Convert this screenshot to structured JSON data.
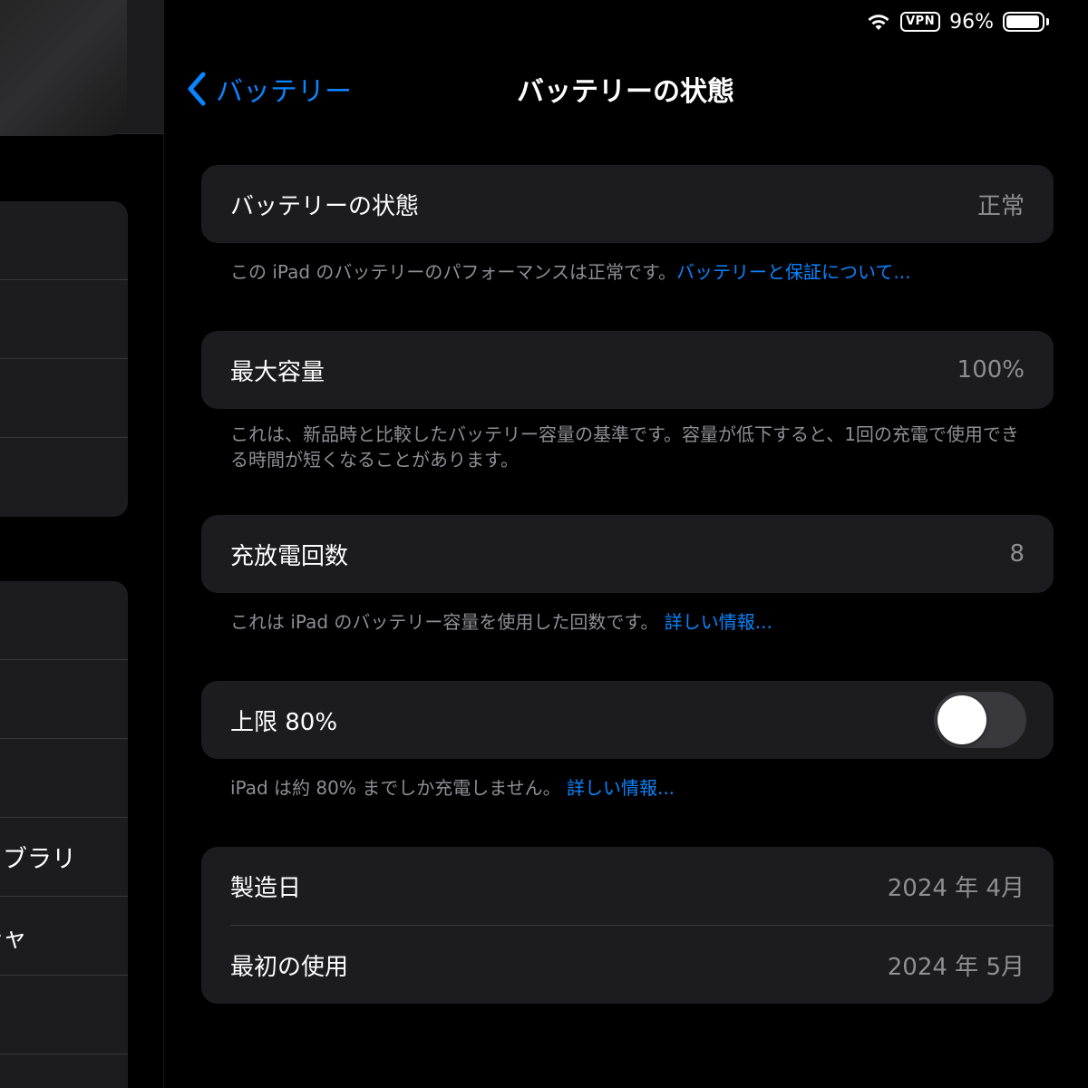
{
  "status_bar": {
    "vpn": "VPN",
    "battery_percent": "96%",
    "battery_level": 0.96,
    "icons": [
      "wifi-icon",
      "vpn-badge",
      "battery-icon"
    ]
  },
  "nav": {
    "back_label": "バッテリー",
    "title": "バッテリーの状態"
  },
  "sidebar": {
    "rows": [
      "",
      "",
      "",
      "",
      "",
      "",
      "",
      "イブラリ",
      "チャ",
      "",
      ""
    ]
  },
  "battery_health": {
    "label": "バッテリーの状態",
    "value": "正常",
    "footnote_text": "この iPad のバッテリーのパフォーマンスは正常です。",
    "footnote_link": "バッテリーと保証について..."
  },
  "max_capacity": {
    "label": "最大容量",
    "value": "100%",
    "footnote_text": "これは、新品時と比較したバッテリー容量の基準です。容量が低下すると、1回の充電で使用できる時間が短くなることがあります。"
  },
  "cycle_count": {
    "label": "充放電回数",
    "value": "8",
    "footnote_text": "これは iPad のバッテリー容量を使用した回数です。",
    "footnote_link": "詳しい情報..."
  },
  "limit": {
    "label": "上限 80%",
    "toggle_on": false,
    "footnote_text": "iPad は約 80% までしか充電しません。",
    "footnote_link": "詳しい情報..."
  },
  "dates": {
    "manufacture_label": "製造日",
    "manufacture_value": "2024 年 4月",
    "first_use_label": "最初の使用",
    "first_use_value": "2024 年 5月"
  },
  "colors": {
    "accent": "#0a84ff",
    "background": "#000000",
    "card": "#1c1c1e",
    "secondary_text": "#8e8e93"
  }
}
